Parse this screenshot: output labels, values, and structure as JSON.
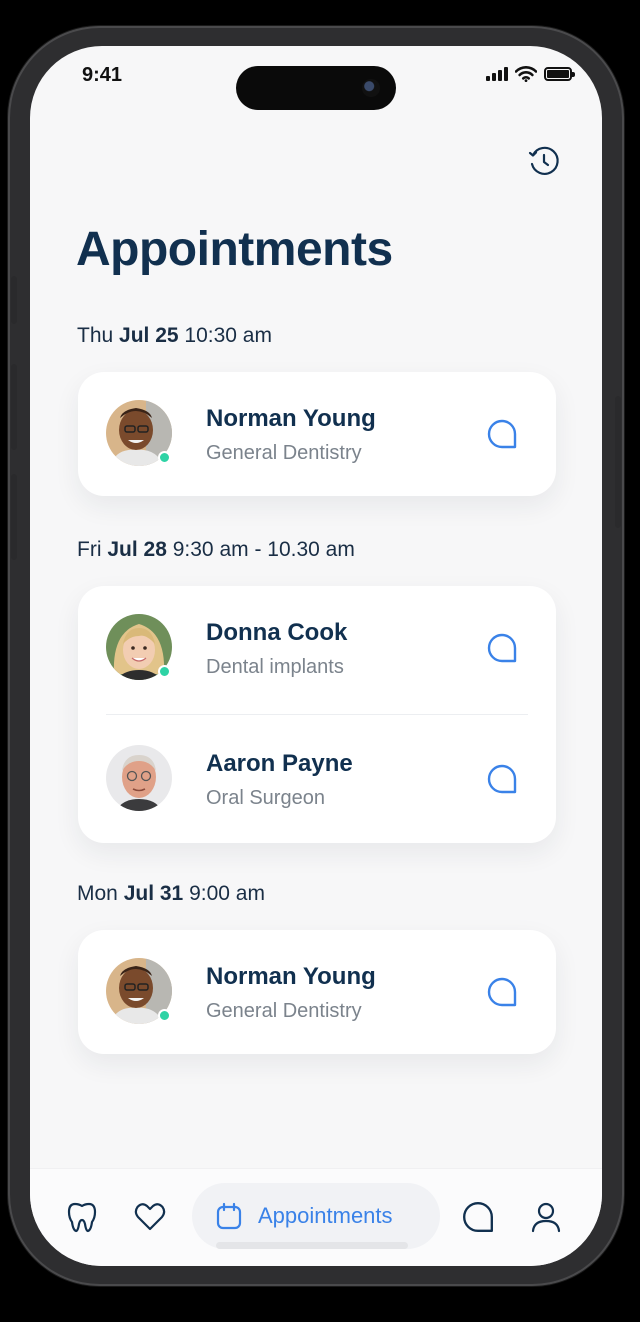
{
  "status_bar": {
    "time": "9:41"
  },
  "header": {
    "title": "Appointments",
    "history_icon": "history-clock-icon"
  },
  "colors": {
    "title": "#11304f",
    "accent": "#3a82e8",
    "online": "#2ed3a5",
    "secondary_text": "#7b838c"
  },
  "groups": [
    {
      "day": "Thu",
      "date": "Jul 25",
      "time": "10:30 am",
      "items": [
        {
          "name": "Norman Young",
          "specialty": "General Dentistry",
          "online": true
        }
      ]
    },
    {
      "day": "Fri",
      "date": "Jul 28",
      "time": "9:30 am - 10.30 am",
      "items": [
        {
          "name": "Donna Cook",
          "specialty": "Dental implants",
          "online": true
        },
        {
          "name": "Aaron Payne",
          "specialty": "Oral Surgeon",
          "online": false
        }
      ]
    },
    {
      "day": "Mon",
      "date": "Jul 31",
      "time": "9:00 am",
      "items": [
        {
          "name": "Norman Young",
          "specialty": "General Dentistry",
          "online": true
        }
      ]
    }
  ],
  "bottom_nav": {
    "items": [
      "tooth-icon",
      "heart-icon",
      "calendar-icon",
      "chat-icon",
      "profile-icon"
    ],
    "active_label": "Appointments"
  }
}
